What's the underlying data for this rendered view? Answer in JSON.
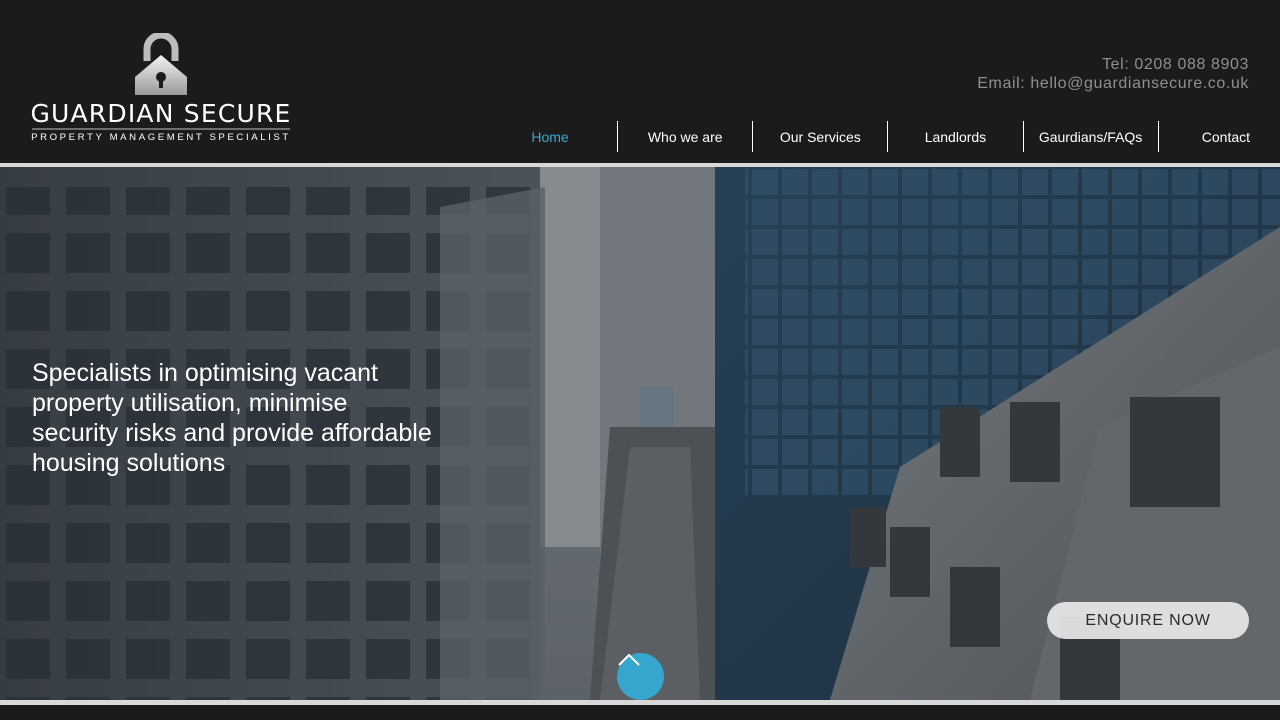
{
  "brand": {
    "name": "GUARDIAN SECURE",
    "tagline": "PROPERTY MANAGEMENT SPECIALIST"
  },
  "contact": {
    "phone": "Tel: 0208 088 8903",
    "email": "Email: hello@guardiansecure.co.uk"
  },
  "nav": {
    "items": [
      {
        "label": "Home",
        "active": true
      },
      {
        "label": "Who we are"
      },
      {
        "label": "Our Services"
      },
      {
        "label": "Landlords"
      },
      {
        "label": "Gaurdians/FAQs"
      },
      {
        "label": "Contact"
      }
    ]
  },
  "hero": {
    "headline": "Specialists in optimising vacant property utilisation, minimise security risks and provide affordable housing solutions",
    "cta": "ENQUIRE NOW",
    "scroll_icon": "chevron-up-icon"
  },
  "colors": {
    "accent": "#37a6cf",
    "header_bg": "#1b1b1b",
    "active_nav": "#3aa9cf"
  }
}
